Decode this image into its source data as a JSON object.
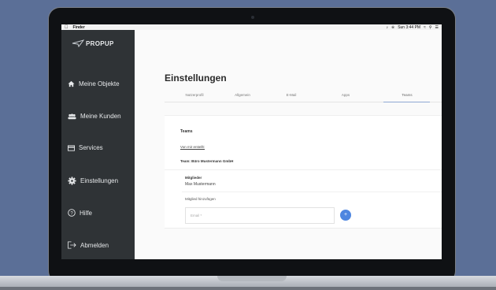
{
  "menubar": {
    "apple_icon": "apple-icon",
    "app_name": "Finder",
    "clock": "Sun 3:44 PM",
    "status_icons": [
      "volume-icon",
      "bluetooth-icon",
      "wifi-icon",
      "search-icon",
      "menu-icon"
    ]
  },
  "sidebar": {
    "logo_text": "PROPUP",
    "items": [
      {
        "icon": "home-icon",
        "label": "Meine Objekte"
      },
      {
        "icon": "people-icon",
        "label": "Meine Kunden"
      },
      {
        "icon": "card-icon",
        "label": "Services"
      },
      {
        "icon": "gear-icon",
        "label": "Einstellungen"
      },
      {
        "icon": "help-icon",
        "label": "Hilfe"
      },
      {
        "icon": "logout-icon",
        "label": "Abmelden"
      }
    ]
  },
  "main": {
    "title": "Einstellungen",
    "tabs": [
      {
        "label": "Nutzerprofil"
      },
      {
        "label": "Allgemein"
      },
      {
        "label": "E-Mail"
      },
      {
        "label": "Apps"
      },
      {
        "label": "Teams"
      }
    ],
    "active_tab": "Teams",
    "teams": {
      "title": "Teams",
      "created_by_me_link": "Von mir erstellt:",
      "team_name": "Team: Büro Mustermann GmbH",
      "members_label": "Mitglieder",
      "member_name": "Max Mustermann",
      "add_member_label": "Mitglied hinzufügen",
      "email_placeholder": "Email *",
      "add_button_label": "+"
    }
  },
  "colors": {
    "sidebar_bg": "#2f3336",
    "accent": "#4e86e0",
    "background": "#5b6f97"
  }
}
